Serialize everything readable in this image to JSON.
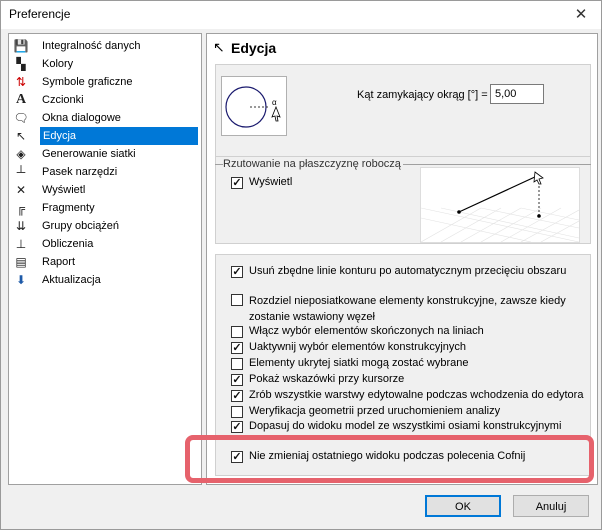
{
  "window": {
    "title": "Preferencje"
  },
  "sidebar": {
    "items": [
      {
        "label": "Integralność danych",
        "icon": "floppy-icon"
      },
      {
        "label": "Kolory",
        "icon": "color-squares-icon"
      },
      {
        "label": "Symbole graficzne",
        "icon": "graphic-symbols-icon"
      },
      {
        "label": "Czcionki",
        "icon": "font-icon"
      },
      {
        "label": "Okna dialogowe",
        "icon": "dialog-icon"
      },
      {
        "label": "Edycja",
        "icon": "edit-icon",
        "selected": true
      },
      {
        "label": "Generowanie siatki",
        "icon": "mesh-icon"
      },
      {
        "label": "Pasek narzędzi",
        "icon": "toolbar-icon"
      },
      {
        "label": "Wyświetl",
        "icon": "display-icon"
      },
      {
        "label": "Fragmenty",
        "icon": "fragments-icon"
      },
      {
        "label": "Grupy obciążeń",
        "icon": "load-groups-icon"
      },
      {
        "label": "Obliczenia",
        "icon": "calculations-icon"
      },
      {
        "label": "Raport",
        "icon": "report-icon"
      },
      {
        "label": "Aktualizacja",
        "icon": "update-icon"
      }
    ]
  },
  "content": {
    "heading": "Edycja",
    "angle": {
      "label": "Kąt zamykający okrąg [°] =",
      "value": "5,00"
    },
    "projection": {
      "title": "Rzutowanie na płaszczyznę roboczą",
      "show_label": "Wyświetl",
      "show_checked": true
    },
    "options": [
      {
        "label": "Usuń zbędne linie konturu po automatycznym przecięciu obszaru",
        "checked": true
      },
      {
        "label": "Rozdziel nieposiatkowane elementy konstrukcyjne, zawsze kiedy zostanie wstawiony węzeł",
        "checked": false
      },
      {
        "label": "Włącz wybór elementów skończonych na liniach",
        "checked": false
      },
      {
        "label": "Uaktywnij wybór elementów konstrukcyjnych",
        "checked": true
      },
      {
        "label": "Elementy ukrytej siatki mogą zostać wybrane",
        "checked": false
      },
      {
        "label": "Pokaż wskazówki przy kursorze",
        "checked": true
      },
      {
        "label": "Zrób wszystkie warstwy edytowalne podczas wchodzenia do edytora",
        "checked": true
      },
      {
        "label": "Weryfikacja geometrii przed uruchomieniem analizy",
        "checked": false
      },
      {
        "label": "Dopasuj do widoku model ze wszystkimi osiami konstrukcyjnymi",
        "checked": true
      },
      {
        "label": "Nie zmieniaj ostatniego widoku podczas polecenia Cofnij",
        "checked": true
      }
    ]
  },
  "buttons": {
    "ok": "OK",
    "cancel": "Anuluj"
  },
  "colors": {
    "selection": "#0078d7",
    "highlight": "#e6626c"
  }
}
